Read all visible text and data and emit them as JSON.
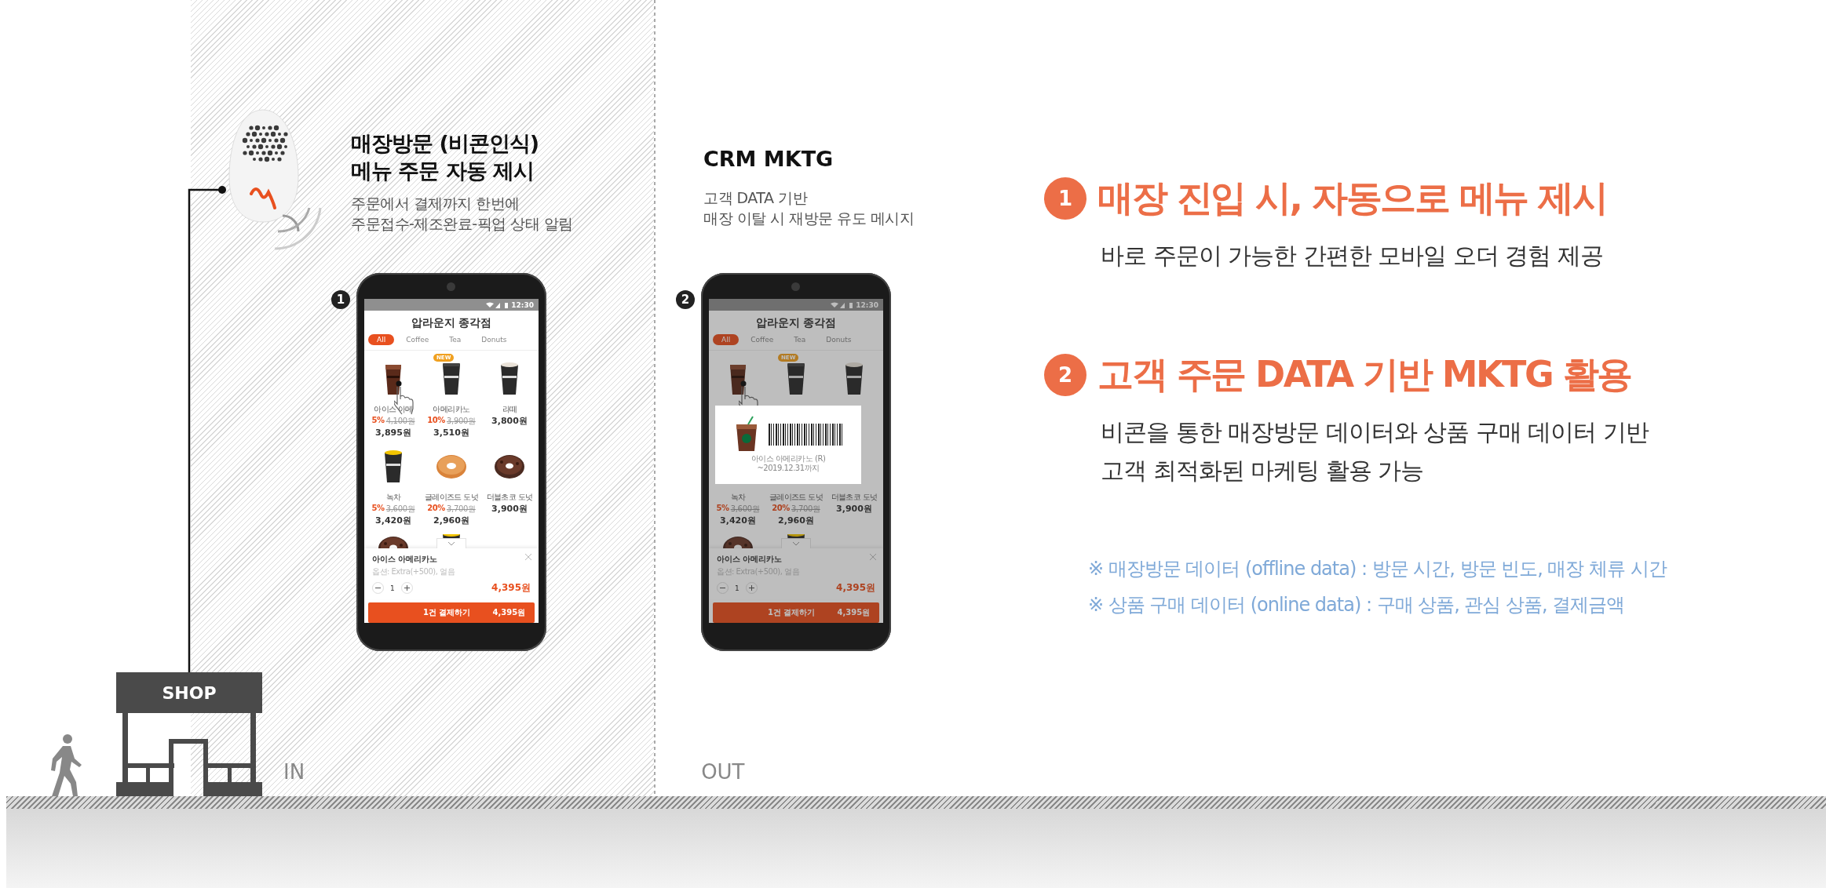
{
  "beacon_text": {
    "title": [
      "매장방문 (비콘인식)",
      "메뉴 주문 자동 제시"
    ],
    "desc": [
      "주문에서 결제까지 한번에",
      "주문접수-제조완료-픽업 상태 알림"
    ]
  },
  "crm_text": {
    "title": "CRM MKTG",
    "desc": [
      "고객 DATA 기반",
      "매장 이탈 시 재방문 유도 메시지"
    ]
  },
  "phones": [
    {
      "number": "1",
      "time": "12:30",
      "store": "압라운지 종각점",
      "tabs": [
        {
          "label": "All",
          "selected": true
        },
        {
          "label": "Coffee",
          "selected": false
        },
        {
          "label": "Tea",
          "selected": false
        },
        {
          "label": "Donuts",
          "selected": false
        }
      ],
      "products": [
        {
          "kind": "iced-coffee",
          "name": "아이스 아메",
          "discount": "5%",
          "old_price": "4,100원",
          "price": "3,895원"
        },
        {
          "kind": "black-cup",
          "badge": "NEW",
          "name": "아메리카노",
          "discount": "10%",
          "old_price": "3,900원",
          "price": "3,510원"
        },
        {
          "kind": "latte",
          "name": "라떼",
          "price": "3,800원"
        },
        {
          "kind": "green-tea",
          "name": "녹차",
          "discount": "5%",
          "old_price": "3,600원",
          "price": "3,420원"
        },
        {
          "kind": "glazed-donut",
          "name": "글레이즈드 도넛",
          "discount": "20%",
          "old_price": "3,700원",
          "price": "2,960원"
        },
        {
          "kind": "choco-donut",
          "name": "더블초코 도넛",
          "price": "3,900원"
        },
        {
          "kind": "choco-donut"
        },
        {
          "kind": "green-tea"
        }
      ],
      "cart": {
        "name": "아이스 아메리카노",
        "option": "옵션: Extra(+500), 얼음",
        "quantity": "1",
        "price": "4,395원"
      },
      "pay_button": {
        "label": "1건 결제하기",
        "amount": "4,395원"
      }
    },
    {
      "number": "2",
      "dimmed": true,
      "time": "12:30",
      "store": "압라운지 종각점",
      "tabs": [
        {
          "label": "All",
          "selected": true
        },
        {
          "label": "Coffee",
          "selected": false
        },
        {
          "label": "Tea",
          "selected": false
        },
        {
          "label": "Donuts",
          "selected": false
        }
      ],
      "products": [
        {
          "kind": "iced-coffee"
        },
        {
          "kind": "black-cup",
          "badge": "NEW"
        },
        {
          "kind": "latte"
        },
        {
          "name": "녹차",
          "discount": "5%",
          "old_price": "3,600원",
          "price": "3,420원"
        },
        {
          "name": "글레이즈드 도넛",
          "discount": "20%",
          "old_price": "3,700원",
          "price": "2,960원"
        },
        {
          "name": "더블초코 도넛",
          "price": "3,900원"
        },
        {
          "kind": "choco-donut"
        },
        {
          "kind": "green-tea"
        }
      ],
      "cart": {
        "name": "아이스 아메리카노",
        "option": "옵션: Extra(+500), 얼음",
        "quantity": "1",
        "price": "4,395원"
      },
      "pay_button": {
        "label": "1건 결제하기",
        "amount": "4,395원"
      },
      "coupon": {
        "name": "아이스 아메리카노 (R)",
        "valid": "~2019.12.31까지"
      }
    }
  ],
  "points": [
    {
      "number": "1",
      "title": "매장 진입 시, 자동으로 메뉴 제시",
      "desc": [
        "바로 주문이 가능한 간편한 모바일 오더 경험 제공"
      ]
    },
    {
      "number": "2",
      "title": "고객 주문 DATA 기반 MKTG 활용",
      "desc": [
        "비콘을 통한 매장방문 데이터와 상품 구매 데이터 기반",
        "고객 최적화된 마케팅 활용 가능"
      ]
    }
  ],
  "notes": [
    "※ 매장방문 데이터 (offline data) : 방문 시간, 방문 빈도, 매장 체류 시간",
    "※ 상품 구매 데이터 (online data) : 구매 상품, 관심 상품, 결제금액"
  ],
  "scene": {
    "shop_sign": "SHOP",
    "in_label": "IN",
    "out_label": "OUT"
  }
}
